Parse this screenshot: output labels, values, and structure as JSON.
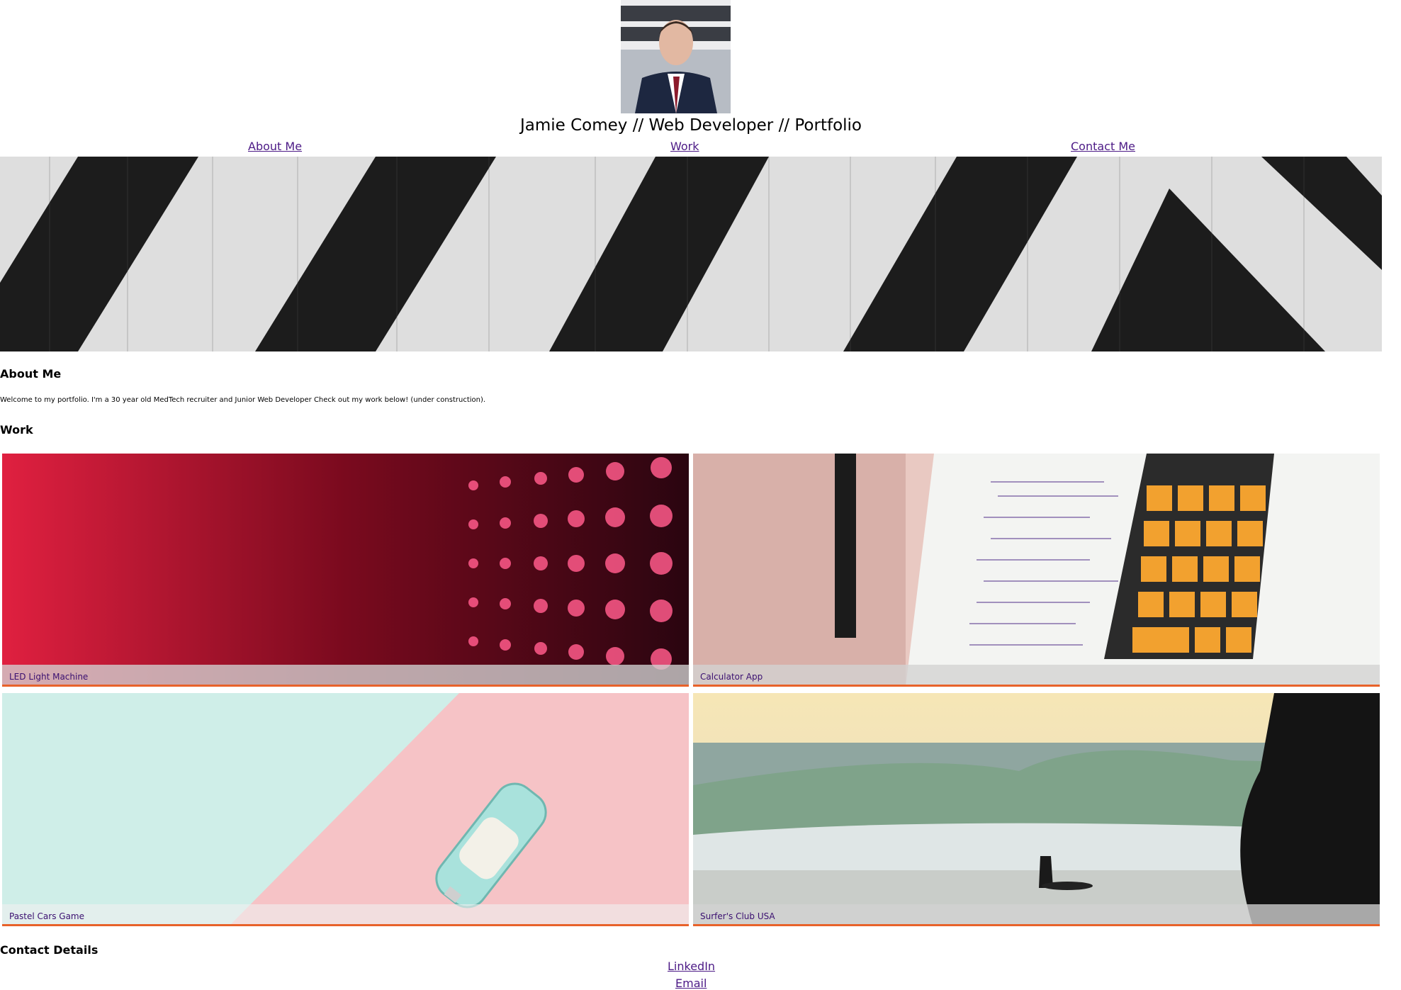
{
  "header": {
    "title": "Jamie Comey // Web Developer // Portfolio",
    "nav": {
      "about": "About Me",
      "work": "Work",
      "contact": "Contact Me"
    }
  },
  "about": {
    "heading": "About Me",
    "text": "Welcome to my portfolio. I'm a 30 year old MedTech recruiter and Junior Web Developer Check out my work below! (under construction)."
  },
  "work": {
    "heading": "Work",
    "items": [
      {
        "label": "LED Light Machine"
      },
      {
        "label": "Calculator App"
      },
      {
        "label": "Pastel Cars Game"
      },
      {
        "label": "Surfer's Club USA"
      }
    ]
  },
  "contact": {
    "heading": "Contact Details",
    "links": {
      "linkedin": "LinkedIn",
      "email": "Email"
    }
  },
  "colors": {
    "link": "#4c1a86",
    "card_accent": "#e8622a"
  }
}
